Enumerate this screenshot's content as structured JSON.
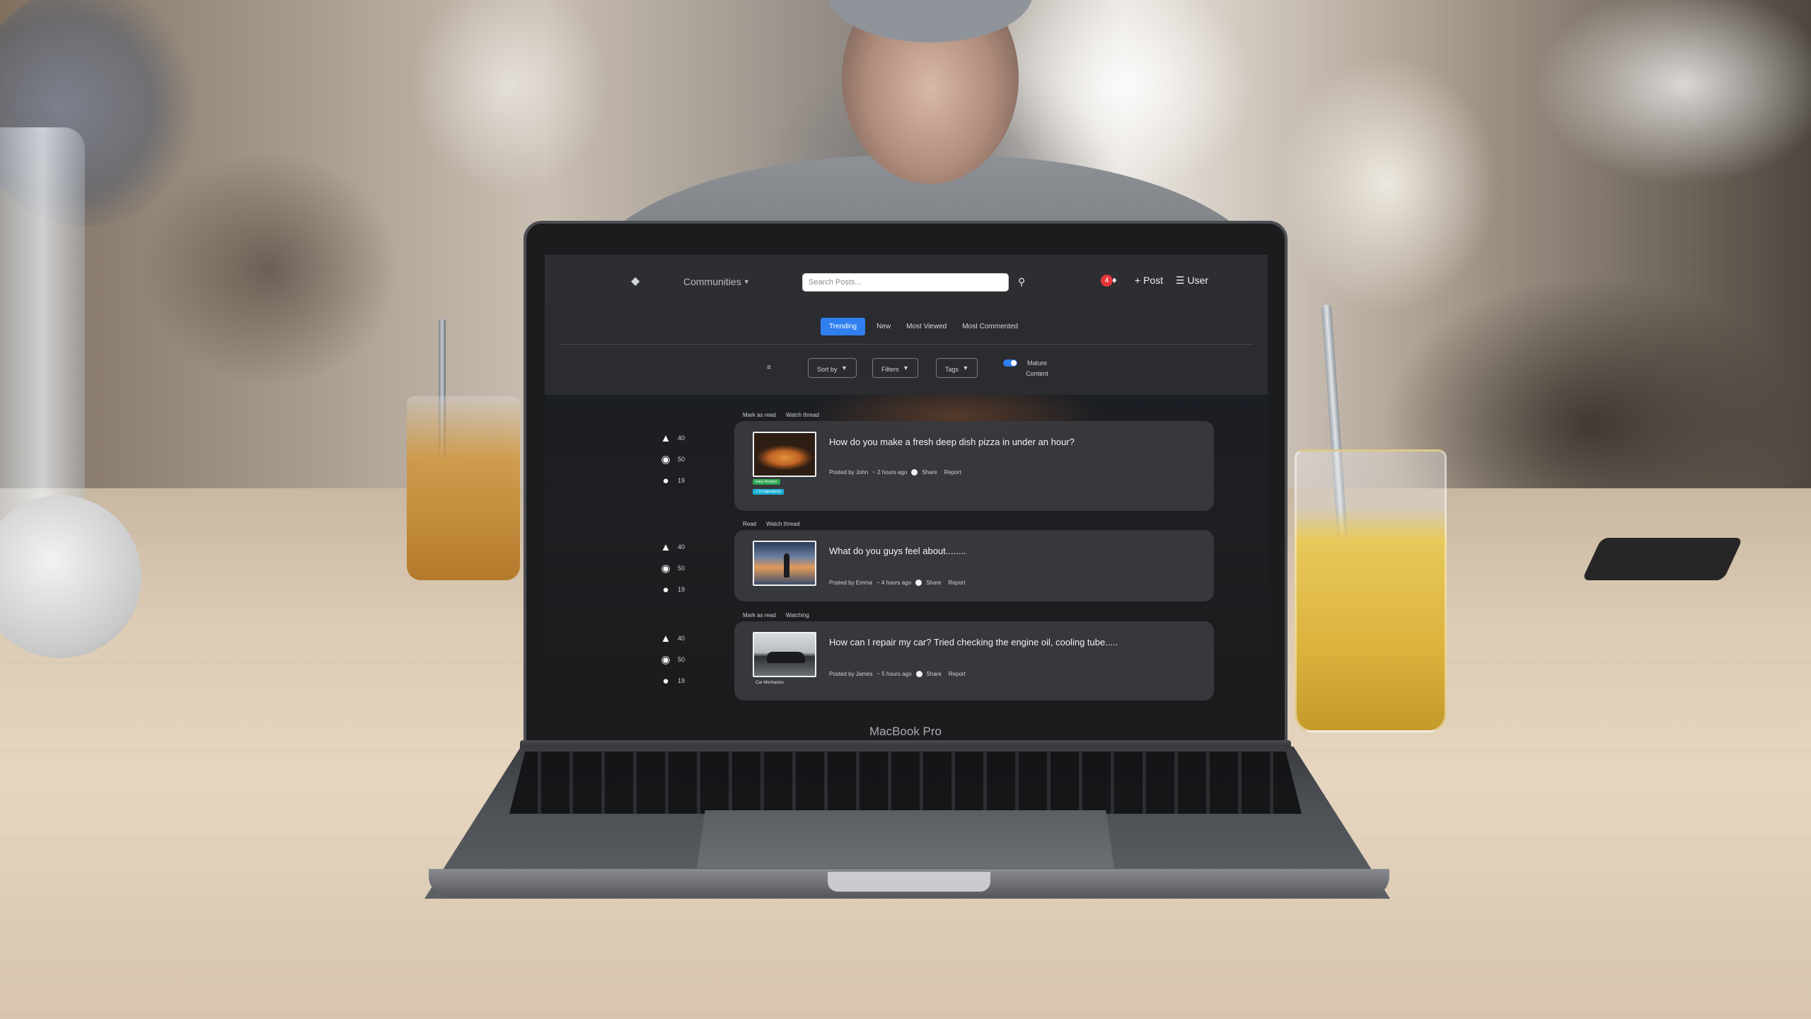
{
  "laptop": {
    "model_label": "MacBook Pro"
  },
  "nav": {
    "communities_label": "Communities",
    "search_placeholder": "Search Posts...",
    "notification_count": "4",
    "post_label": "Post",
    "user_label": "User"
  },
  "tabs": [
    {
      "label": "Trending",
      "active": true
    },
    {
      "label": "New",
      "active": false
    },
    {
      "label": "Most Viewed",
      "active": false
    },
    {
      "label": "Most Commented",
      "active": false
    }
  ],
  "filters": {
    "sort_label": "Sort by",
    "filters_label": "Filters",
    "tags_label": "Tags",
    "mature_label": "Mature Content",
    "mature_enabled": true
  },
  "posts": [
    {
      "actions": [
        "Mark as read",
        "Watch thread"
      ],
      "likes": "40",
      "views": "50",
      "comments": "19",
      "title": "How do you make a fresh deep dish pizza in under an hour?",
      "author_text": "Posted by John",
      "time_text": "~ 2 hours ago",
      "share_label": "Share",
      "report_label": "Report",
      "tags": [
        "Easy Recipes",
        "< 10 Ingredients"
      ]
    },
    {
      "actions": [
        "Read",
        "Watch thread"
      ],
      "likes": "40",
      "views": "50",
      "comments": "19",
      "title": "What do you guys feel about........",
      "author_text": "Posted by Emma",
      "time_text": "~ 4 hours ago",
      "share_label": "Share",
      "report_label": "Report",
      "tags": []
    },
    {
      "actions": [
        "Mark as read",
        "Watching"
      ],
      "likes": "40",
      "views": "50",
      "comments": "19",
      "title": "How can I repair my car? Tried checking the engine oil, cooling tube.....",
      "author_text": "Posted by James",
      "time_text": "~ 5 hours ago",
      "share_label": "Share",
      "report_label": "Report",
      "tags": [
        "Car Mechanics"
      ]
    }
  ],
  "colors": {
    "accent": "#2f7fef",
    "badge": "#e5363c",
    "tag_green": "#2ea84f",
    "tag_cyan": "#1ab0d6"
  },
  "icons": [
    "logo-icon",
    "search-icon",
    "bell-icon",
    "plus-icon",
    "menu-icon",
    "list-icon",
    "thumbs-up-icon",
    "eye-icon",
    "comment-icon"
  ]
}
